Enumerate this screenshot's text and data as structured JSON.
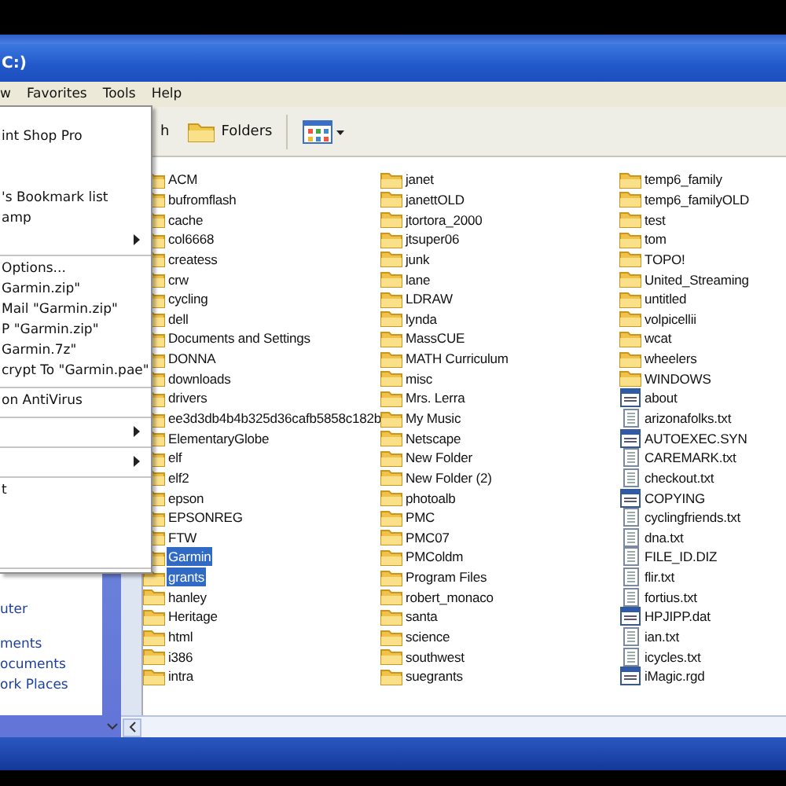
{
  "window": {
    "title": "C:)"
  },
  "menu_bar": [
    "w",
    "Favorites",
    "Tools",
    "Help"
  ],
  "toolbar": {
    "search_label": "h",
    "folders_label": "Folders"
  },
  "context_menu": [
    {
      "kind": "blank"
    },
    {
      "kind": "item",
      "label": "int Shop Pro"
    },
    {
      "kind": "blank"
    },
    {
      "kind": "blank"
    },
    {
      "kind": "item",
      "label": "'s Bookmark list"
    },
    {
      "kind": "item",
      "label": "amp"
    },
    {
      "kind": "submenu"
    },
    {
      "kind": "separator"
    },
    {
      "kind": "item",
      "label": "Options..."
    },
    {
      "kind": "item",
      "label": "Garmin.zip\""
    },
    {
      "kind": "item",
      "label": "Mail \"Garmin.zip\""
    },
    {
      "kind": "item",
      "label": "P \"Garmin.zip\""
    },
    {
      "kind": "item",
      "label": "Garmin.7z\""
    },
    {
      "kind": "item",
      "label": "crypt To \"Garmin.pae\""
    },
    {
      "kind": "separator"
    },
    {
      "kind": "item",
      "label": "on AntiVirus"
    },
    {
      "kind": "separator"
    },
    {
      "kind": "submenu"
    },
    {
      "kind": "separator"
    },
    {
      "kind": "submenu"
    },
    {
      "kind": "separator"
    },
    {
      "kind": "item",
      "label": "t"
    },
    {
      "kind": "blank"
    },
    {
      "kind": "blank"
    },
    {
      "kind": "blank"
    },
    {
      "kind": "separator"
    }
  ],
  "task_pane": {
    "links": [
      "uter",
      "ments",
      "ocuments",
      "ork Places"
    ]
  },
  "file_columns": [
    [
      {
        "name": "ACM",
        "kind": "folder",
        "selected": false
      },
      {
        "name": "bufromflash",
        "kind": "folder",
        "selected": false
      },
      {
        "name": "cache",
        "kind": "folder",
        "selected": false
      },
      {
        "name": "col6668",
        "kind": "folder",
        "selected": false
      },
      {
        "name": "createss",
        "kind": "folder",
        "selected": false
      },
      {
        "name": "crw",
        "kind": "folder",
        "selected": false
      },
      {
        "name": "cycling",
        "kind": "folder",
        "selected": false
      },
      {
        "name": "dell",
        "kind": "folder",
        "selected": false
      },
      {
        "name": "Documents and Settings",
        "kind": "folder",
        "selected": false
      },
      {
        "name": "DONNA",
        "kind": "folder",
        "selected": false
      },
      {
        "name": "downloads",
        "kind": "folder",
        "selected": false
      },
      {
        "name": "drivers",
        "kind": "folder",
        "selected": false
      },
      {
        "name": "ee3d3db4b4b325d36cafb5858c182b",
        "kind": "folder",
        "selected": false
      },
      {
        "name": "ElementaryGlobe",
        "kind": "folder",
        "selected": false
      },
      {
        "name": "elf",
        "kind": "folder",
        "selected": false
      },
      {
        "name": "elf2",
        "kind": "folder",
        "selected": false
      },
      {
        "name": "epson",
        "kind": "folder",
        "selected": false
      },
      {
        "name": "EPSONREG",
        "kind": "folder",
        "selected": false
      },
      {
        "name": "FTW",
        "kind": "folder",
        "selected": false
      },
      {
        "name": "Garmin",
        "kind": "folder",
        "selected": true
      },
      {
        "name": "grants",
        "kind": "folder",
        "selected": true
      },
      {
        "name": "hanley",
        "kind": "folder",
        "selected": false
      },
      {
        "name": "Heritage",
        "kind": "folder",
        "selected": false
      },
      {
        "name": "html",
        "kind": "folder",
        "selected": false
      },
      {
        "name": "i386",
        "kind": "folder",
        "selected": false
      },
      {
        "name": "intra",
        "kind": "folder",
        "selected": false
      }
    ],
    [
      {
        "name": "janet",
        "kind": "folder",
        "selected": false
      },
      {
        "name": "janettOLD",
        "kind": "folder",
        "selected": false
      },
      {
        "name": "jtortora_2000",
        "kind": "folder",
        "selected": false
      },
      {
        "name": "jtsuper06",
        "kind": "folder",
        "selected": false
      },
      {
        "name": "junk",
        "kind": "folder",
        "selected": false
      },
      {
        "name": "lane",
        "kind": "folder",
        "selected": false
      },
      {
        "name": "LDRAW",
        "kind": "folder",
        "selected": false
      },
      {
        "name": "lynda",
        "kind": "folder",
        "selected": false
      },
      {
        "name": "MassCUE",
        "kind": "folder",
        "selected": false
      },
      {
        "name": "MATH Curriculum",
        "kind": "folder",
        "selected": false
      },
      {
        "name": "misc",
        "kind": "folder",
        "selected": false
      },
      {
        "name": "Mrs. Lerra",
        "kind": "folder",
        "selected": false
      },
      {
        "name": "My Music",
        "kind": "folder",
        "selected": false
      },
      {
        "name": "Netscape",
        "kind": "folder",
        "selected": false
      },
      {
        "name": "New Folder",
        "kind": "folder",
        "selected": false
      },
      {
        "name": "New Folder (2)",
        "kind": "folder",
        "selected": false
      },
      {
        "name": "photoalb",
        "kind": "folder",
        "selected": false
      },
      {
        "name": "PMC",
        "kind": "folder",
        "selected": false
      },
      {
        "name": "PMC07",
        "kind": "folder",
        "selected": false
      },
      {
        "name": "PMColdm",
        "kind": "folder",
        "selected": false
      },
      {
        "name": "Program Files",
        "kind": "folder",
        "selected": false
      },
      {
        "name": "robert_monaco",
        "kind": "folder",
        "selected": false
      },
      {
        "name": "santa",
        "kind": "folder",
        "selected": false
      },
      {
        "name": "science",
        "kind": "folder",
        "selected": false
      },
      {
        "name": "southwest",
        "kind": "folder",
        "selected": false
      },
      {
        "name": "suegrants",
        "kind": "folder",
        "selected": false
      }
    ],
    [
      {
        "name": "temp6_family",
        "kind": "folder",
        "selected": false
      },
      {
        "name": "temp6_familyOLD",
        "kind": "folder",
        "selected": false
      },
      {
        "name": "test",
        "kind": "folder",
        "selected": false
      },
      {
        "name": "tom",
        "kind": "folder",
        "selected": false
      },
      {
        "name": "TOPO!",
        "kind": "folder",
        "selected": false
      },
      {
        "name": "United_Streaming",
        "kind": "folder",
        "selected": false
      },
      {
        "name": "untitled",
        "kind": "folder",
        "selected": false
      },
      {
        "name": "volpicellii",
        "kind": "folder",
        "selected": false
      },
      {
        "name": "wcat",
        "kind": "folder",
        "selected": false
      },
      {
        "name": "wheelers",
        "kind": "folder",
        "selected": false
      },
      {
        "name": "WINDOWS",
        "kind": "folder",
        "selected": false
      },
      {
        "name": "about",
        "kind": "system",
        "selected": false
      },
      {
        "name": "arizonafolks.txt",
        "kind": "text",
        "selected": false
      },
      {
        "name": "AUTOEXEC.SYN",
        "kind": "system",
        "selected": false
      },
      {
        "name": "CAREMARK.txt",
        "kind": "text",
        "selected": false
      },
      {
        "name": "checkout.txt",
        "kind": "text",
        "selected": false
      },
      {
        "name": "COPYING",
        "kind": "system",
        "selected": false
      },
      {
        "name": "cyclingfriends.txt",
        "kind": "text",
        "selected": false
      },
      {
        "name": "dna.txt",
        "kind": "text",
        "selected": false
      },
      {
        "name": "FILE_ID.DIZ",
        "kind": "text",
        "selected": false
      },
      {
        "name": "flir.txt",
        "kind": "text",
        "selected": false
      },
      {
        "name": "fortius.txt",
        "kind": "text",
        "selected": false
      },
      {
        "name": "HPJIPP.dat",
        "kind": "system",
        "selected": false
      },
      {
        "name": "ian.txt",
        "kind": "text",
        "selected": false
      },
      {
        "name": "icycles.txt",
        "kind": "text",
        "selected": false
      },
      {
        "name": "iMagic.rgd",
        "kind": "system",
        "selected": false
      }
    ]
  ]
}
